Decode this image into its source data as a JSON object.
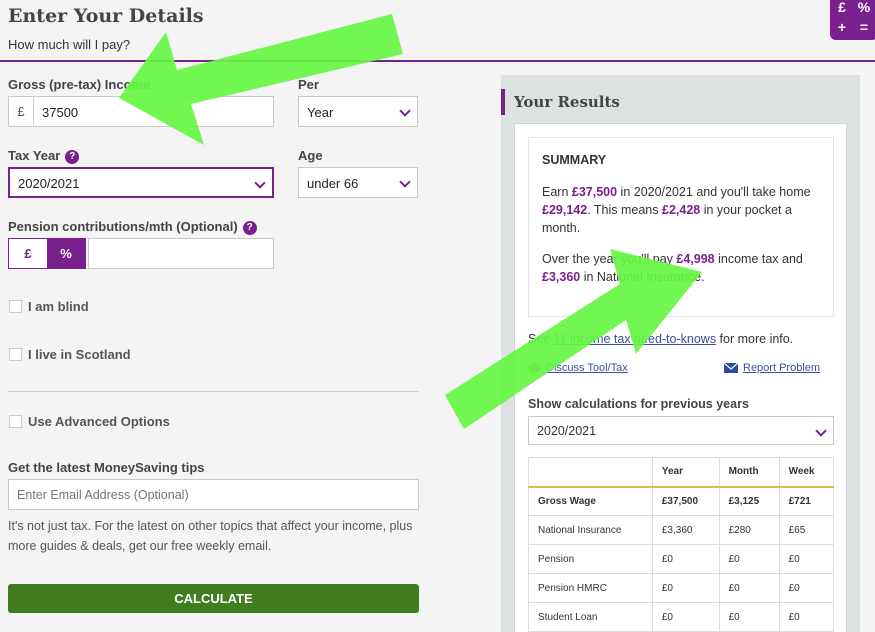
{
  "header": {
    "title": "Enter Your Details",
    "subtitle": "How much will I pay?"
  },
  "calc_icon": {
    "keys": [
      "£",
      "%",
      "+",
      "="
    ],
    "name": "calculator-icon"
  },
  "income": {
    "label": "Gross (pre-tax) Income",
    "currency": "£",
    "value": "37500"
  },
  "per": {
    "label": "Per",
    "value": "Year"
  },
  "tax_year": {
    "label": "Tax Year",
    "help": "?",
    "value": "2020/2021"
  },
  "age": {
    "label": "Age",
    "value": "under 66"
  },
  "pension": {
    "label": "Pension contributions/mth (Optional)",
    "help": "?",
    "toggle_pound": "£",
    "toggle_percent": "%",
    "value": ""
  },
  "options": {
    "blind": "I am blind",
    "scotland": "I live in Scotland",
    "advanced": "Use Advanced Options"
  },
  "newsletter": {
    "heading": "Get the latest MoneySaving tips",
    "placeholder": "Enter Email Address (Optional)",
    "description": "It's not just tax. For the latest on other topics that affect your income, plus more guides & deals, get our free weekly email."
  },
  "calculate_label": "CALCULATE",
  "results": {
    "title": "Your Results",
    "summary_heading": "SUMMARY",
    "s1_a": "Earn ",
    "s1_earn": "£37,500",
    "s1_b": " in 2020/2021 and you'll take home ",
    "s1_home": "£29,142",
    "s1_c": ". This means ",
    "s1_pocket": "£2,428",
    "s1_d": " in your pocket a month.",
    "s2_a": "Over the year you'll pay ",
    "s2_tax": "£4,998",
    "s2_b": " income tax and ",
    "s2_ni": "£3,360",
    "s2_c": " in National Insurance.",
    "see_a": "See ",
    "see_link": "11 income tax need-to-knows",
    "see_b": " for more info.",
    "discuss": "Discuss Tool/Tax",
    "report": "Report Problem",
    "prev_heading": "Show calculations for previous years",
    "prev_year": "2020/2021",
    "table": {
      "headers": [
        "",
        "Year",
        "Month",
        "Week"
      ],
      "rows": [
        [
          "Gross Wage",
          "£37,500",
          "£3,125",
          "£721"
        ],
        [
          "National Insurance",
          "£3,360",
          "£280",
          "£65"
        ],
        [
          "Pension",
          "£0",
          "£0",
          "£0"
        ],
        [
          "Pension HMRC",
          "£0",
          "£0",
          "£0"
        ],
        [
          "Student Loan",
          "£0",
          "£0",
          "£0"
        ]
      ]
    }
  },
  "colors": {
    "accent": "#7a1f8e",
    "button": "#3f7d1f",
    "arrow": "#66f542"
  }
}
